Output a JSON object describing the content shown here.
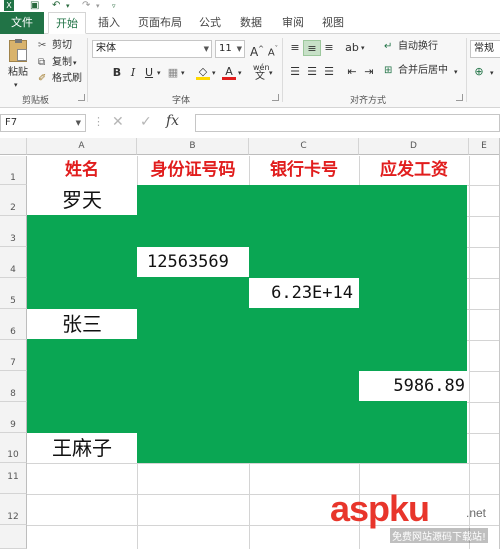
{
  "quick_access": {
    "icons": [
      "excel-logo-icon",
      "save-icon",
      "undo-icon",
      "redo-icon",
      "customize-icon"
    ]
  },
  "tabs": [
    "文件",
    "开始",
    "插入",
    "页面布局",
    "公式",
    "数据",
    "审阅",
    "视图"
  ],
  "clipboard": {
    "paste": "粘贴",
    "cut": "剪切",
    "copy": "复制",
    "format_painter": "格式刷",
    "group": "剪贴板"
  },
  "font": {
    "name": "宋体",
    "size": "11",
    "group": "字体",
    "bold": "B",
    "italic": "I",
    "underline": "U",
    "grow": "A",
    "shrink": "A",
    "color_letter": "A",
    "wen": "wén"
  },
  "alignment": {
    "wrap": "自动换行",
    "merge": "合并后居中",
    "group": "对齐方式"
  },
  "number": {
    "format": "常规"
  },
  "formula_bar": {
    "name_box": "F7",
    "fx": "fx",
    "value": ""
  },
  "columns": [
    "A",
    "B",
    "C",
    "D",
    "E"
  ],
  "rows": [
    "1",
    "2",
    "3",
    "4",
    "5",
    "6",
    "7",
    "8",
    "9",
    "10",
    "11",
    "12"
  ],
  "headers": {
    "name": "姓名",
    "id_no": "身份证号码",
    "bank_card": "银行卡号",
    "salary": "应发工资"
  },
  "cells": {
    "a2": "罗天",
    "b4": "12563569",
    "c5": "6.23E+14",
    "a6": "张三",
    "d8": "5986.89",
    "a10": "王麻子"
  },
  "watermark": {
    "brand": "aspku",
    "tld": ".net",
    "tagline": "免费网站源码下载站!"
  },
  "colors": {
    "green_fill": "#0aa653",
    "header_red": "#e11d1d",
    "excel_green": "#217346"
  }
}
